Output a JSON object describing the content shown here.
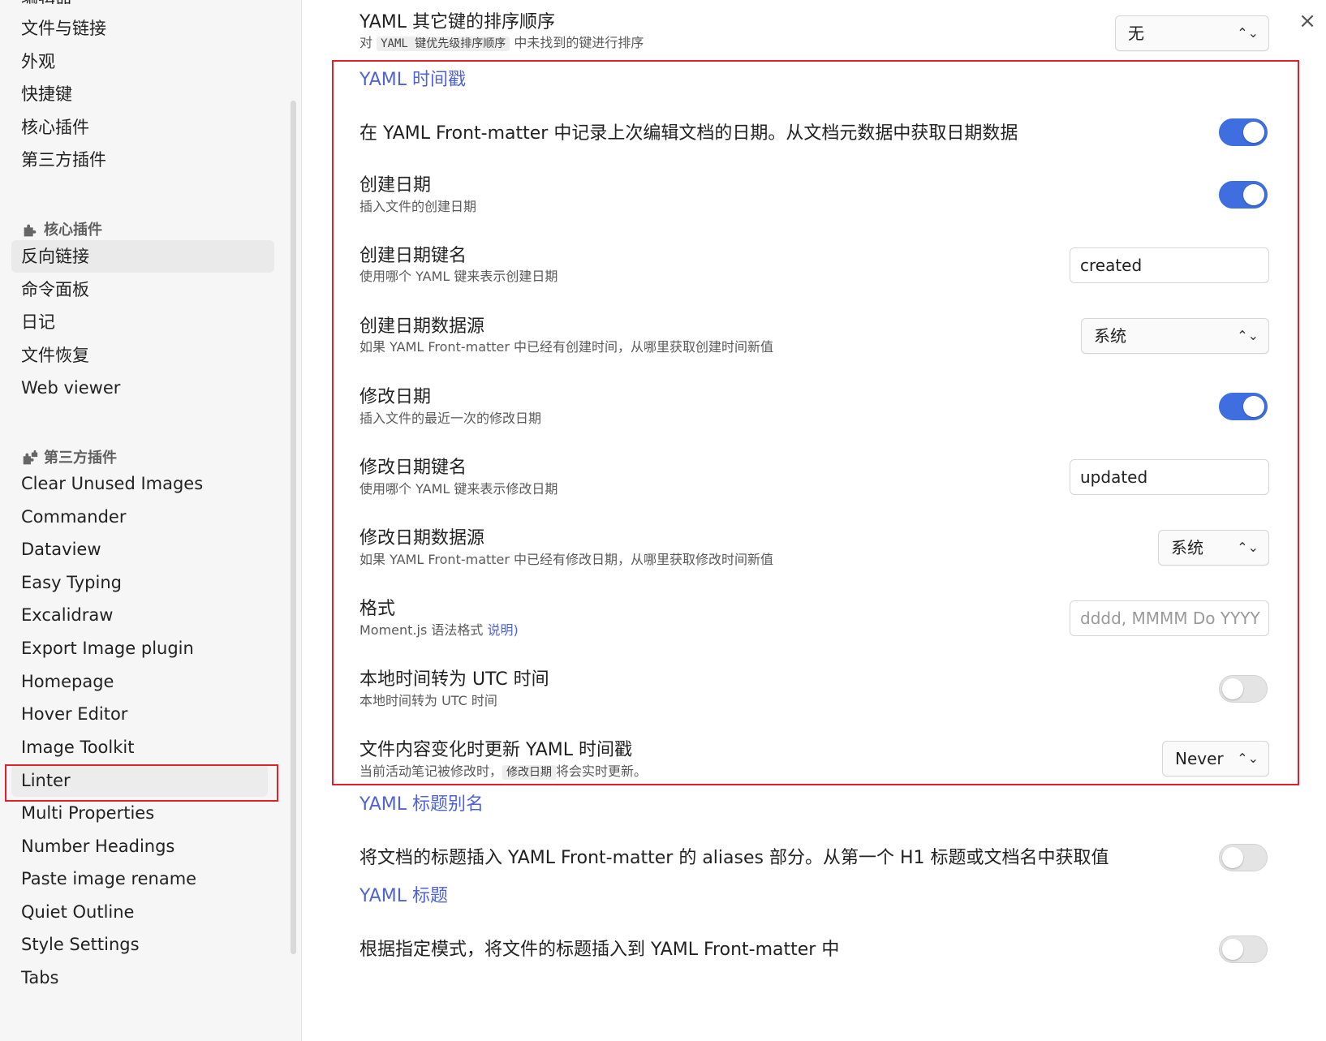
{
  "colors": {
    "accent": "#4f63d6",
    "toggle_on": "#3f6ee0",
    "highlight_box": "#e0202a"
  },
  "sidebar": {
    "cut_top": "编辑器",
    "top_items": [
      "文件与链接",
      "外观",
      "快捷键",
      "核心插件",
      "第三方插件"
    ],
    "core_header": "核心插件",
    "core_icon": "puzzle-icon",
    "core_items": [
      "反向链接",
      "命令面板",
      "日记",
      "文件恢复",
      "Web viewer"
    ],
    "third_header": "第三方插件",
    "third_icon": "puzzle-multi-icon",
    "third_items": [
      "Clear Unused Images",
      "Commander",
      "Dataview",
      "Easy Typing",
      "Excalidraw",
      "Export Image plugin",
      "Homepage",
      "Hover Editor",
      "Image Toolkit",
      "Linter",
      "Multi Properties",
      "Number Headings",
      "Paste image rename",
      "Quiet Outline",
      "Style Settings",
      "Tabs"
    ],
    "active_item": "反向链接",
    "highlighted_item": "Linter"
  },
  "main": {
    "close_icon": "×",
    "sort_other": {
      "title": "YAML 其它键的排序顺序",
      "desc_pre": "对",
      "desc_code": "YAML 键优先级排序顺序",
      "desc_post": "中未找到的键进行排序",
      "value": "无"
    },
    "timestamp_section": "YAML 时间戳",
    "record_edit": {
      "title": "在 YAML Front-matter 中记录上次编辑文档的日期。从文档元数据中获取日期数据",
      "on": true
    },
    "created_date": {
      "title": "创建日期",
      "desc": "插入文件的创建日期",
      "on": true
    },
    "created_key": {
      "title": "创建日期键名",
      "desc": "使用哪个 YAML 键来表示创建日期",
      "value": "created"
    },
    "created_source": {
      "title": "创建日期数据源",
      "desc": "如果 YAML Front-matter 中已经有创建时间，从哪里获取创建时间新值",
      "value": "系统"
    },
    "modified_date": {
      "title": "修改日期",
      "desc": "插入文件的最近一次的修改日期",
      "on": true
    },
    "modified_key": {
      "title": "修改日期键名",
      "desc": "使用哪个 YAML 键来表示修改日期",
      "value": "updated"
    },
    "modified_source": {
      "title": "修改日期数据源",
      "desc": "如果 YAML Front-matter 中已经有修改日期，从哪里获取修改时间新值",
      "value": "系统"
    },
    "format": {
      "title": "格式",
      "desc": "Moment.js 语法格式",
      "link": "说明)",
      "placeholder": "dddd, MMMM Do YYYY"
    },
    "utc": {
      "title": "本地时间转为 UTC 时间",
      "desc": "本地时间转为 UTC 时间",
      "on": false
    },
    "update_on_change": {
      "title": "文件内容变化时更新 YAML 时间戳",
      "desc_pre": "当前活动笔记被修改时，",
      "desc_code": "修改日期",
      "desc_post": "将会实时更新。",
      "value": "Never"
    },
    "alias_section": "YAML 标题别名",
    "alias": {
      "title": "将文档的标题插入 YAML Front-matter 的 aliases 部分。从第一个 H1 标题或文档名中获取值",
      "on": false
    },
    "title_section": "YAML 标题",
    "title_insert": {
      "title": "根据指定模式，将文件的标题插入到 YAML Front-matter 中",
      "on": false
    }
  }
}
